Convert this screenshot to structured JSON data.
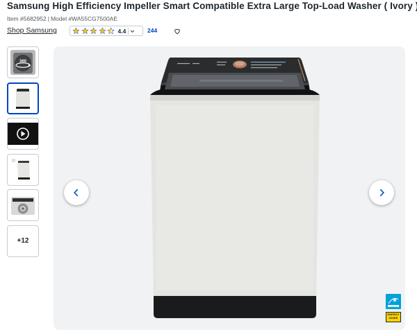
{
  "product": {
    "title": "Samsung High Efficiency Impeller Smart Compatible Extra Large Top-Load Washer ( Ivory ) ENERGY STAR",
    "item_label": "Item #5682952",
    "separator": "|",
    "model_label": "Model #WA55CG7500AE"
  },
  "brand": {
    "link_text": "Shop Samsung"
  },
  "rating": {
    "value": "4.4",
    "stars": 4.4,
    "max_stars": 5,
    "review_count": "244",
    "star_color": "#0046be",
    "star_fill": "#ffc220"
  },
  "gallery": {
    "thumbnails": [
      {
        "name": "360-view",
        "icon": "rotate-360-icon",
        "label": "360"
      },
      {
        "name": "front-view",
        "icon": "washer-image",
        "label": ""
      },
      {
        "name": "video",
        "icon": "play-icon",
        "label": ""
      },
      {
        "name": "side-view",
        "icon": "washer-image",
        "label": ""
      },
      {
        "name": "top-view",
        "icon": "washer-top-image",
        "label": ""
      }
    ],
    "more_label": "+12",
    "selected_index": 1
  },
  "badges": {
    "energy_star": "energy star",
    "energy_guide": "ENERGY GUIDE"
  },
  "colors": {
    "accent": "#0046be",
    "viewer_bg": "#f0f2f4"
  }
}
